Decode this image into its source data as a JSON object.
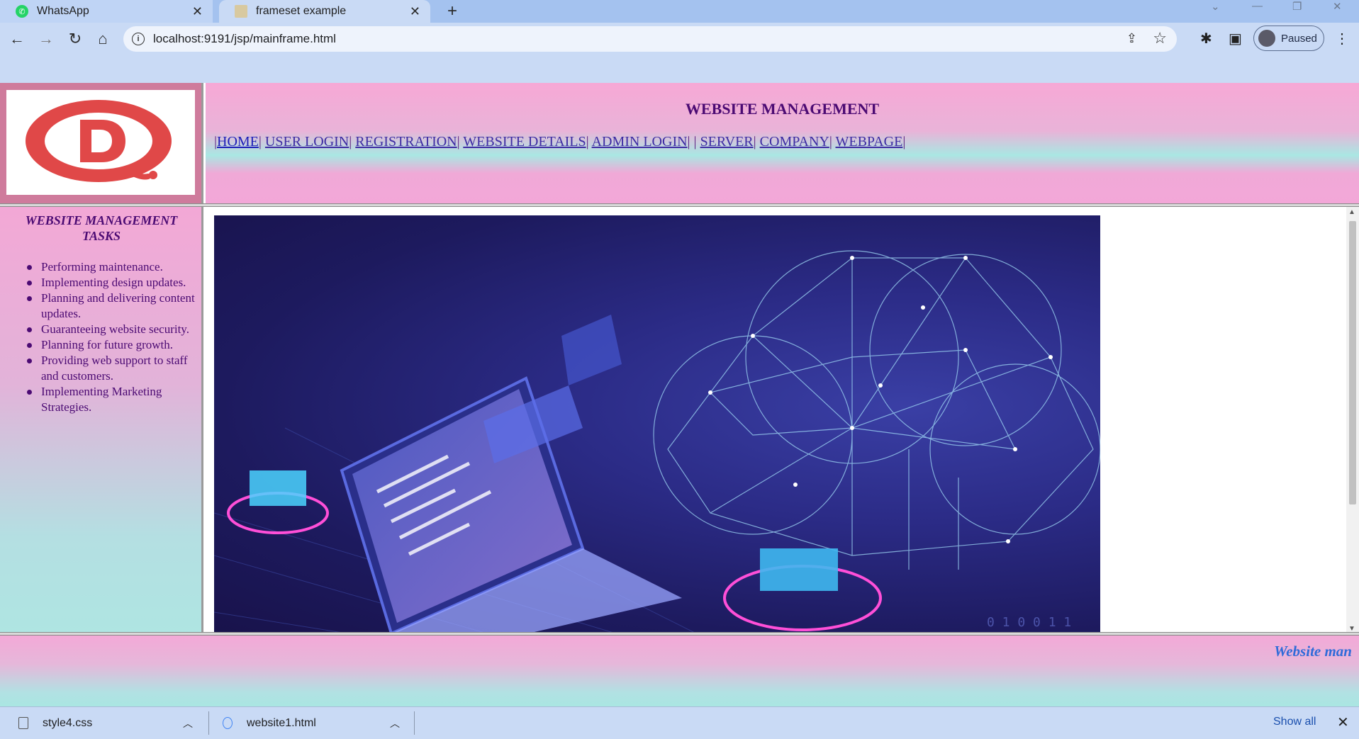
{
  "browser": {
    "tabs": [
      {
        "title": "WhatsApp",
        "active": false
      },
      {
        "title": "frameset example",
        "active": true
      }
    ],
    "url": "localhost:9191/jsp/mainframe.html",
    "profile_label": "Paused"
  },
  "header": {
    "title": "WEBSITE MANAGEMENT",
    "menu": [
      "HOME",
      "USER LOGIN",
      "REGISTRATION",
      "WEBSITE DETAILS",
      "ADMIN LOGIN",
      "SERVER",
      "COMPANY",
      "WEBPAGE"
    ]
  },
  "sidebar": {
    "title": "WEBSITE MANAGEMENT TASKS",
    "tasks": [
      "Performing maintenance.",
      "Implementing design updates.",
      "Planning and delivering content updates.",
      "Guaranteeing website security.",
      "Planning for future growth.",
      "Providing web support to staff and customers.",
      "Implementing Marketing Strategies."
    ]
  },
  "footer": {
    "marquee": "Website man"
  },
  "downloads": {
    "items": [
      "style4.css",
      "website1.html"
    ],
    "show_all": "Show all"
  },
  "colors": {
    "logo_red": "#e04848",
    "title_purple": "#4b0a73",
    "link_blue": "#3d2ba3",
    "marquee_blue": "#2f6bd9"
  }
}
